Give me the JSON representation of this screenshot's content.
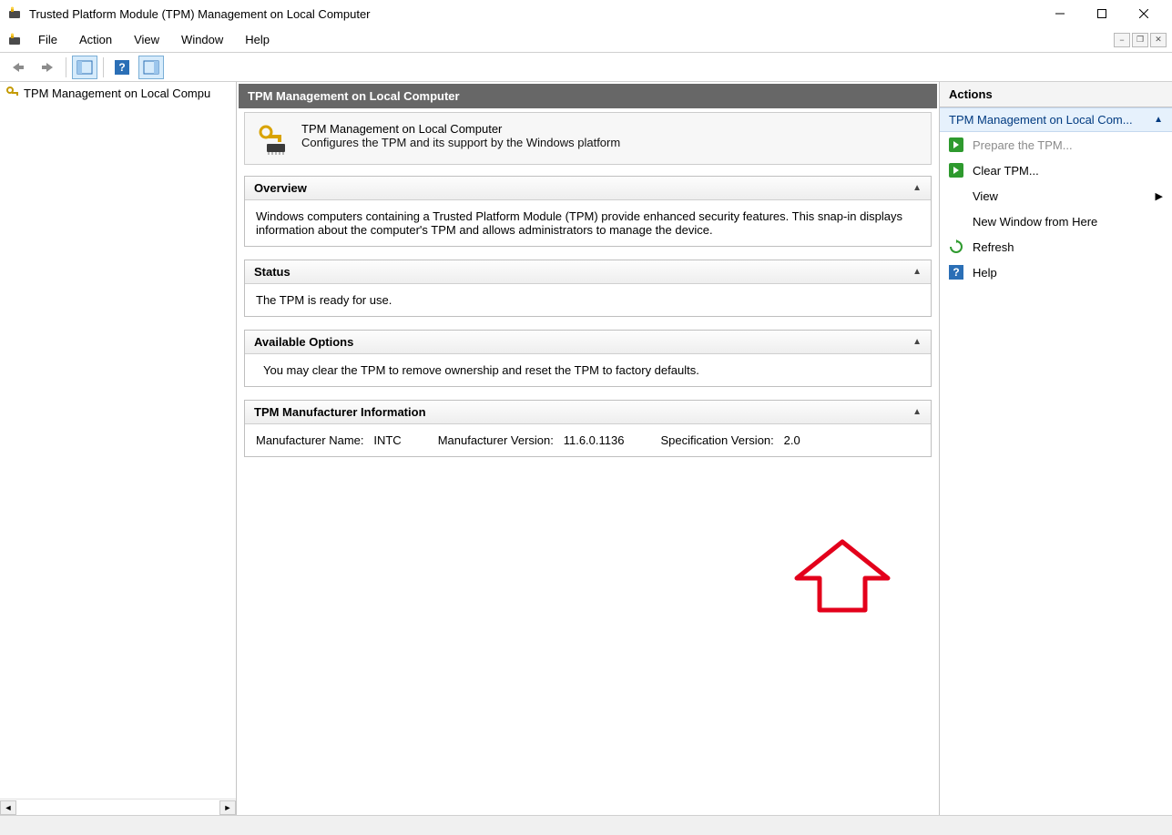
{
  "window": {
    "title": "Trusted Platform Module (TPM) Management on Local Computer"
  },
  "menu": {
    "items": [
      "File",
      "Action",
      "View",
      "Window",
      "Help"
    ]
  },
  "tree": {
    "root_label": "TPM Management on Local Compu"
  },
  "center": {
    "header": "TPM Management on Local Computer",
    "intro_title": "TPM Management on Local Computer",
    "intro_desc": "Configures the TPM and its support by the Windows platform",
    "overview": {
      "title": "Overview",
      "body": "Windows computers containing a Trusted Platform Module (TPM) provide enhanced security features. This snap-in displays information about the computer's TPM and allows administrators to manage the device."
    },
    "status": {
      "title": "Status",
      "body": "The TPM is ready for use."
    },
    "options": {
      "title": "Available Options",
      "body": "You may clear the TPM to remove ownership and reset the TPM to factory defaults."
    },
    "mfr": {
      "title": "TPM Manufacturer Information",
      "name_label": "Manufacturer Name:",
      "name_value": "INTC",
      "version_label": "Manufacturer Version:",
      "version_value": "11.6.0.1136",
      "spec_label": "Specification Version:",
      "spec_value": "2.0"
    }
  },
  "actions": {
    "title": "Actions",
    "group_label": "TPM Management on Local Com...",
    "items": [
      {
        "label": "Prepare the TPM...",
        "icon": "green-arrow",
        "disabled": true
      },
      {
        "label": "Clear TPM...",
        "icon": "green-arrow",
        "disabled": false
      },
      {
        "label": "View",
        "icon": "none",
        "disabled": false,
        "submenu": true
      },
      {
        "label": "New Window from Here",
        "icon": "none",
        "disabled": false
      },
      {
        "label": "Refresh",
        "icon": "refresh",
        "disabled": false
      },
      {
        "label": "Help",
        "icon": "help",
        "disabled": false
      }
    ]
  }
}
